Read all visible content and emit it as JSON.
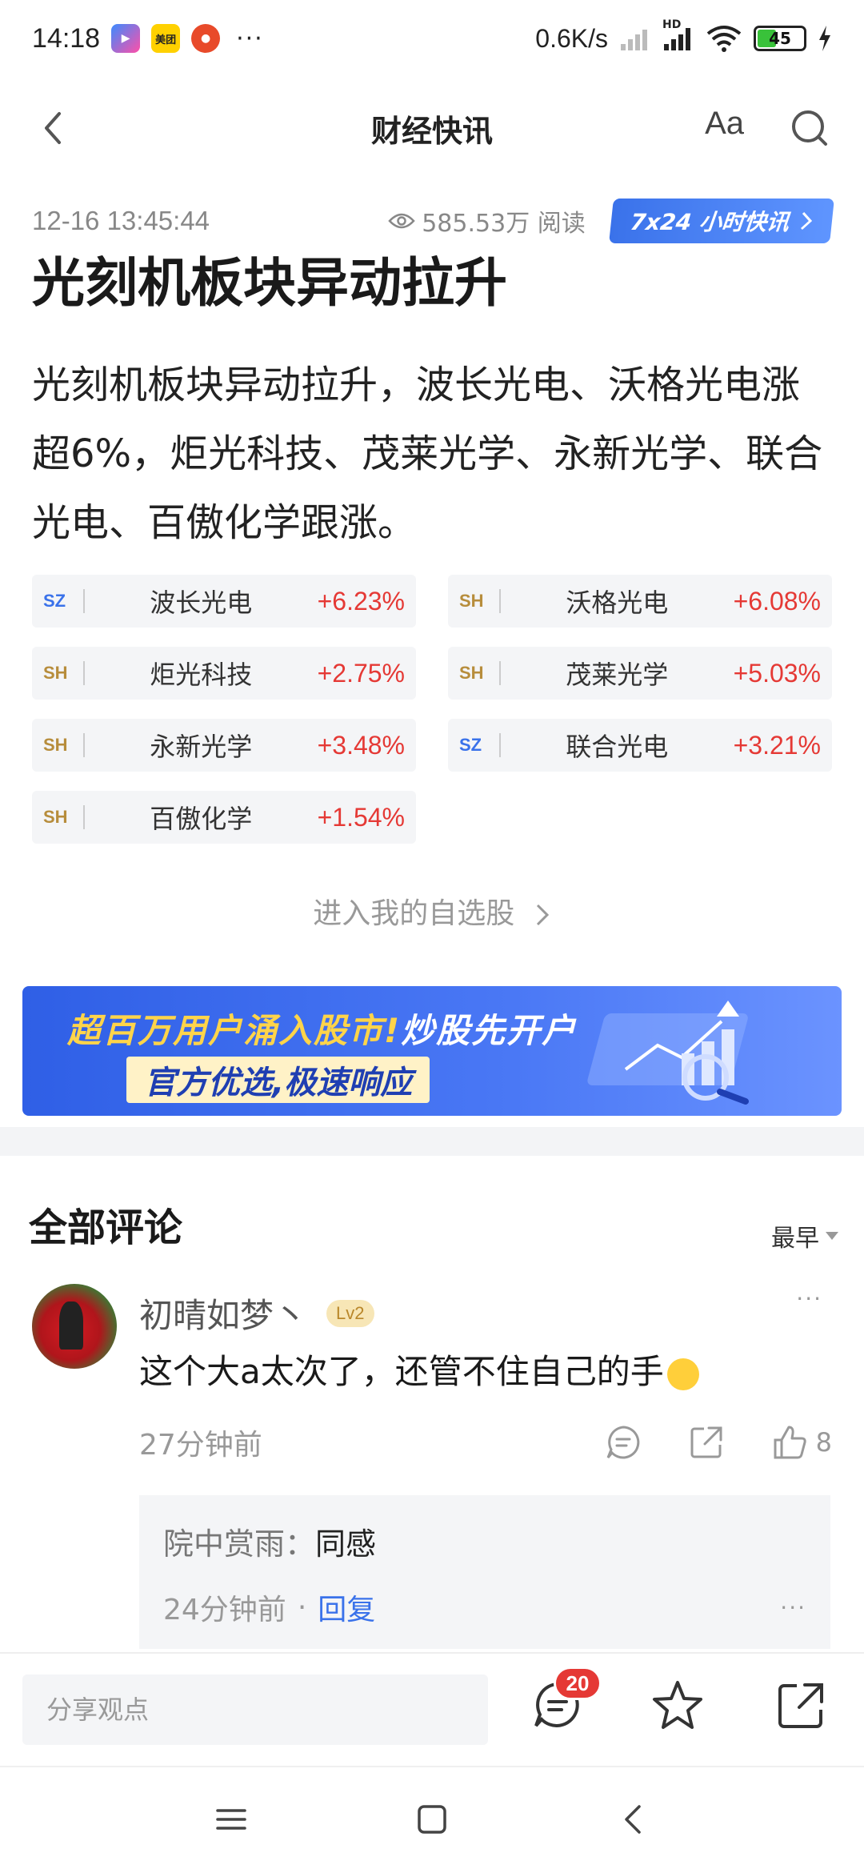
{
  "status_bar": {
    "time": "14:18",
    "meituan_label": "美团",
    "dots": "···",
    "net_speed": "0.6K/s",
    "network_label": "HD",
    "battery_level": 45
  },
  "nav": {
    "title": "财经快讯",
    "font_label": "Aa"
  },
  "article": {
    "timestamp": "12-16 13:45:44",
    "views": "585.53万 阅读",
    "live_button": "7x24 小时快讯",
    "headline": "光刻机板块异动拉升",
    "summary": "光刻机板块异动拉升，波长光电、沃格光电涨超6%，炬光科技、茂莱光学、永新光学、联合光电、百傲化学跟涨。",
    "stocks": [
      {
        "market": "SZ",
        "name": "波长光电",
        "change": "+6.23%"
      },
      {
        "market": "SH",
        "name": "沃格光电",
        "change": "+6.08%"
      },
      {
        "market": "SH",
        "name": "炬光科技",
        "change": "+2.75%"
      },
      {
        "market": "SH",
        "name": "茂莱光学",
        "change": "+5.03%"
      },
      {
        "market": "SH",
        "name": "永新光学",
        "change": "+3.48%"
      },
      {
        "market": "SZ",
        "name": "联合光电",
        "change": "+3.21%"
      },
      {
        "market": "SH",
        "name": "百傲化学",
        "change": "+1.54%"
      }
    ],
    "watchlist_link": "进入我的自选股"
  },
  "banner": {
    "line1_a": "超百万用户涌入股市!",
    "line1_b": "炒股先开户",
    "line2": "官方优选,极速响应"
  },
  "comments": {
    "title": "全部评论",
    "sort_label": "最早",
    "items": [
      {
        "username": "初晴如梦丶",
        "level": "Lv2",
        "text": "这个大a太次了，还管不住自己的手",
        "time": "27分钟前",
        "likes": "8",
        "replies": [
          {
            "author": "院中赏雨：",
            "text": "同感",
            "time": "24分钟前",
            "reply_label": "回复"
          }
        ]
      }
    ]
  },
  "bottom_bar": {
    "share_placeholder": "分享观点",
    "comment_count": "20"
  },
  "colors": {
    "accent_blue": "#3a72ea",
    "rise_red": "#e53935",
    "market_sh": "#b78d3c"
  }
}
